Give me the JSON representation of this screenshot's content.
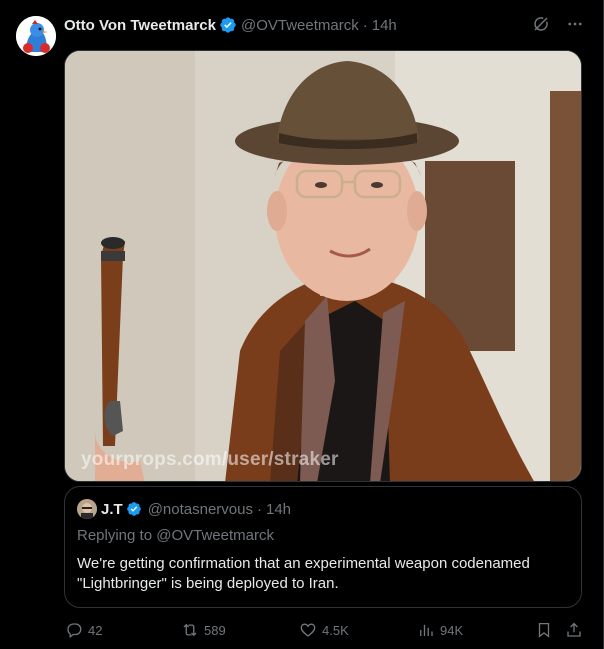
{
  "tweet": {
    "author_name": "Otto Von Tweetmarck",
    "author_handle": "@OVTweetmarck",
    "separator": "·",
    "time": "14h",
    "media_watermark": "yourprops.com/user/straker"
  },
  "quoted": {
    "author_name": "J.T",
    "author_handle": "@notasnervous",
    "separator": "·",
    "time": "14h",
    "replying_to": "Replying to @OVTweetmarck",
    "text": "We're getting confirmation that an experimental weapon codenamed \"Lightbringer\" is being deployed to Iran."
  },
  "actions": {
    "replies": "42",
    "retweets": "589",
    "likes": "4.5K",
    "views": "94K"
  },
  "icons": {
    "verified": "verified-badge-icon",
    "grok": "grok-icon",
    "more": "more-icon",
    "reply": "reply-icon",
    "retweet": "retweet-icon",
    "like": "heart-icon",
    "views": "views-icon",
    "bookmark": "bookmark-icon",
    "share": "share-icon"
  },
  "colors": {
    "background": "#000000",
    "text": "#e7e9ea",
    "muted": "#71767b",
    "border": "#2f3336",
    "verified": "#1d9bf0"
  }
}
